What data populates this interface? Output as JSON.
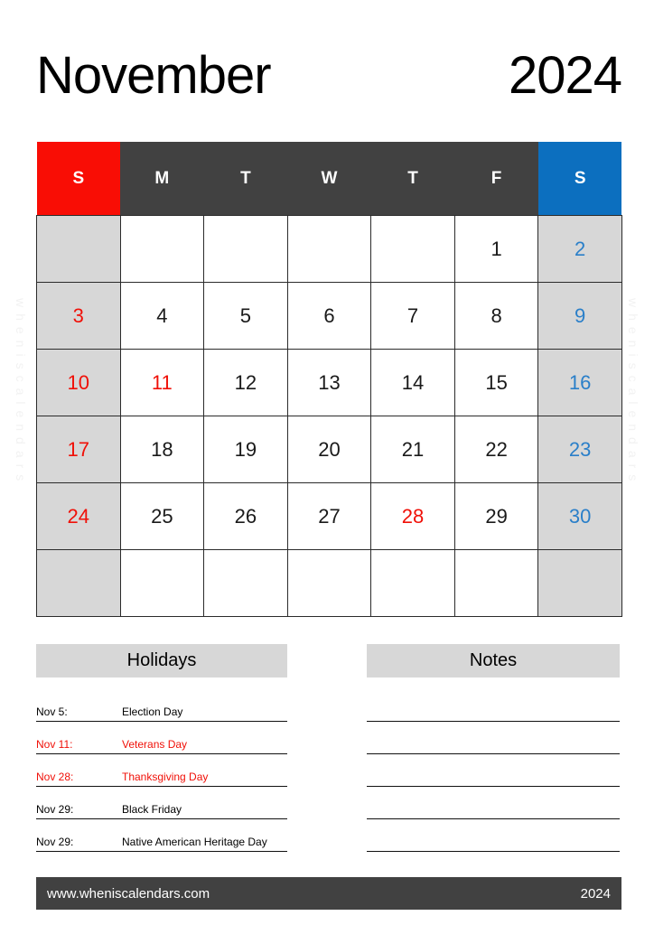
{
  "document": {
    "month": "November",
    "year": "2024"
  },
  "watermark": {
    "text": "wheniscalendars"
  },
  "calendar": {
    "weekday_headers": [
      {
        "label": "S",
        "kind": "sun"
      },
      {
        "label": "M",
        "kind": "weekday"
      },
      {
        "label": "T",
        "kind": "weekday"
      },
      {
        "label": "W",
        "kind": "weekday"
      },
      {
        "label": "T",
        "kind": "weekday"
      },
      {
        "label": "F",
        "kind": "weekday"
      },
      {
        "label": "S",
        "kind": "sat"
      }
    ],
    "weeks": [
      [
        {
          "day": "",
          "kind": "sun-empty"
        },
        {
          "day": "",
          "kind": "empty"
        },
        {
          "day": "",
          "kind": "empty"
        },
        {
          "day": "",
          "kind": "empty"
        },
        {
          "day": "",
          "kind": "empty"
        },
        {
          "day": "1",
          "kind": "normal"
        },
        {
          "day": "2",
          "kind": "sat"
        }
      ],
      [
        {
          "day": "3",
          "kind": "sun"
        },
        {
          "day": "4",
          "kind": "normal"
        },
        {
          "day": "5",
          "kind": "normal"
        },
        {
          "day": "6",
          "kind": "normal"
        },
        {
          "day": "7",
          "kind": "normal"
        },
        {
          "day": "8",
          "kind": "normal"
        },
        {
          "day": "9",
          "kind": "sat"
        }
      ],
      [
        {
          "day": "10",
          "kind": "sun"
        },
        {
          "day": "11",
          "kind": "holiday"
        },
        {
          "day": "12",
          "kind": "normal"
        },
        {
          "day": "13",
          "kind": "normal"
        },
        {
          "day": "14",
          "kind": "normal"
        },
        {
          "day": "15",
          "kind": "normal"
        },
        {
          "day": "16",
          "kind": "sat"
        }
      ],
      [
        {
          "day": "17",
          "kind": "sun"
        },
        {
          "day": "18",
          "kind": "normal"
        },
        {
          "day": "19",
          "kind": "normal"
        },
        {
          "day": "20",
          "kind": "normal"
        },
        {
          "day": "21",
          "kind": "normal"
        },
        {
          "day": "22",
          "kind": "normal"
        },
        {
          "day": "23",
          "kind": "sat"
        }
      ],
      [
        {
          "day": "24",
          "kind": "sun"
        },
        {
          "day": "25",
          "kind": "normal"
        },
        {
          "day": "26",
          "kind": "normal"
        },
        {
          "day": "27",
          "kind": "normal"
        },
        {
          "day": "28",
          "kind": "holiday"
        },
        {
          "day": "29",
          "kind": "normal"
        },
        {
          "day": "30",
          "kind": "sat"
        }
      ],
      [
        {
          "day": "",
          "kind": "sun-empty"
        },
        {
          "day": "",
          "kind": "empty"
        },
        {
          "day": "",
          "kind": "empty"
        },
        {
          "day": "",
          "kind": "empty"
        },
        {
          "day": "",
          "kind": "empty"
        },
        {
          "day": "",
          "kind": "empty"
        },
        {
          "day": "",
          "kind": "sat-empty"
        }
      ]
    ]
  },
  "holidays": {
    "title": "Holidays",
    "items": [
      {
        "date": "Nov 5:",
        "name": "Election Day",
        "highlight": false
      },
      {
        "date": "Nov 11:",
        "name": "Veterans Day",
        "highlight": true
      },
      {
        "date": "Nov 28:",
        "name": "Thanksgiving Day",
        "highlight": true
      },
      {
        "date": "Nov 29:",
        "name": "Black Friday",
        "highlight": false
      },
      {
        "date": "Nov 29:",
        "name": "Native American Heritage Day",
        "highlight": false
      }
    ]
  },
  "notes": {
    "title": "Notes",
    "line_count": 5
  },
  "footer": {
    "site": "www.wheniscalendars.com",
    "year": "2024"
  },
  "colors": {
    "sunday_header": "#f90d05",
    "saturday_header": "#0c6fbf",
    "weekday_header": "#414141",
    "weekend_cell": "#d7d7d7",
    "holiday_text": "#f01008",
    "saturday_text": "#2a7fc9",
    "panel_header": "#d7d7d7",
    "footer_bar": "#414141"
  }
}
